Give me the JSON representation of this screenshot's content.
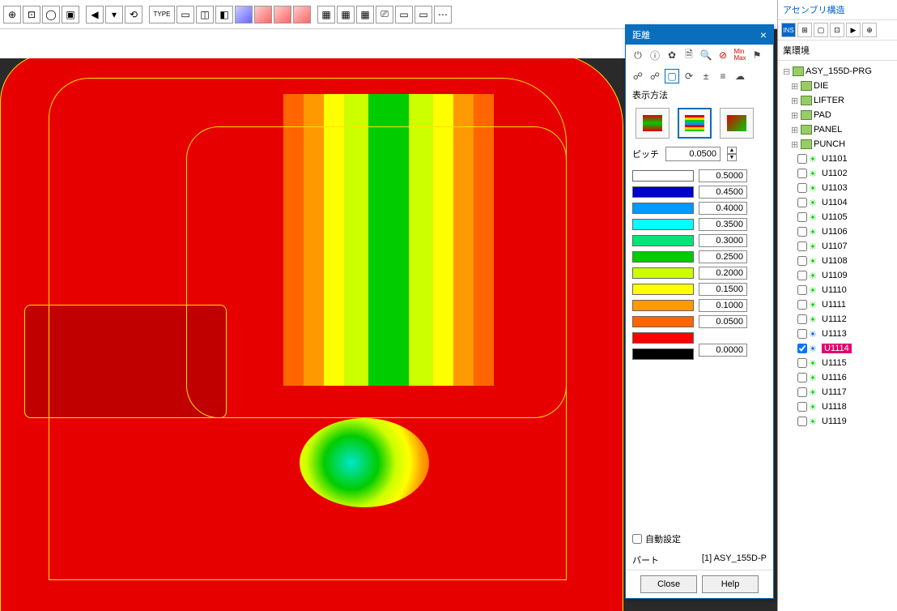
{
  "app": {
    "toolbar_label_type": "TYPE"
  },
  "dialog": {
    "title": "距離",
    "display_label": "表示方法",
    "pitch_label": "ピッチ",
    "pitch_value": "0.0500",
    "legend": [
      {
        "color": "#ffffff",
        "value": "0.5000"
      },
      {
        "color": "#0000cc",
        "value": "0.4500"
      },
      {
        "color": "#0099ff",
        "value": "0.4000"
      },
      {
        "color": "#00ffff",
        "value": "0.3500"
      },
      {
        "color": "#00e676",
        "value": "0.3000"
      },
      {
        "color": "#00cc00",
        "value": "0.2500"
      },
      {
        "color": "#ccff00",
        "value": "0.2000"
      },
      {
        "color": "#ffff00",
        "value": "0.1500"
      },
      {
        "color": "#ff9900",
        "value": "0.1000"
      },
      {
        "color": "#ff6600",
        "value": "0.0500"
      },
      {
        "color": "#ff0000",
        "value": ""
      },
      {
        "color": "#000000",
        "value": "0.0000"
      }
    ],
    "auto_label": "自動設定",
    "part_label": "パート",
    "part_value": "[1] ASY_155D-P",
    "close": "Close",
    "help": "Help"
  },
  "tree": {
    "header": "アセンブリ構造",
    "env": "業環境",
    "root": "ASY_155D-PRG",
    "groups": [
      "DIE",
      "LIFTER",
      "PAD",
      "PANEL",
      "PUNCH"
    ],
    "items": [
      {
        "label": "U1101",
        "bulb": "green",
        "checked": false,
        "hl": false
      },
      {
        "label": "U1102",
        "bulb": "green",
        "checked": false,
        "hl": false
      },
      {
        "label": "U1103",
        "bulb": "green",
        "checked": false,
        "hl": false
      },
      {
        "label": "U1104",
        "bulb": "green",
        "checked": false,
        "hl": false
      },
      {
        "label": "U1105",
        "bulb": "green",
        "checked": false,
        "hl": false
      },
      {
        "label": "U1106",
        "bulb": "green",
        "checked": false,
        "hl": false
      },
      {
        "label": "U1107",
        "bulb": "green",
        "checked": false,
        "hl": false
      },
      {
        "label": "U1108",
        "bulb": "green",
        "checked": false,
        "hl": false
      },
      {
        "label": "U1109",
        "bulb": "green",
        "checked": false,
        "hl": false
      },
      {
        "label": "U1110",
        "bulb": "green",
        "checked": false,
        "hl": false
      },
      {
        "label": "U1111",
        "bulb": "green",
        "checked": false,
        "hl": false
      },
      {
        "label": "U1112",
        "bulb": "green",
        "checked": false,
        "hl": false
      },
      {
        "label": "U1113",
        "bulb": "blue",
        "checked": false,
        "hl": false
      },
      {
        "label": "U1114",
        "bulb": "blue",
        "checked": true,
        "hl": true
      },
      {
        "label": "U1115",
        "bulb": "green",
        "checked": false,
        "hl": false
      },
      {
        "label": "U1116",
        "bulb": "green",
        "checked": false,
        "hl": false
      },
      {
        "label": "U1117",
        "bulb": "green",
        "checked": false,
        "hl": false
      },
      {
        "label": "U1118",
        "bulb": "green",
        "checked": false,
        "hl": false
      },
      {
        "label": "U1119",
        "bulb": "green",
        "checked": false,
        "hl": false
      }
    ]
  }
}
